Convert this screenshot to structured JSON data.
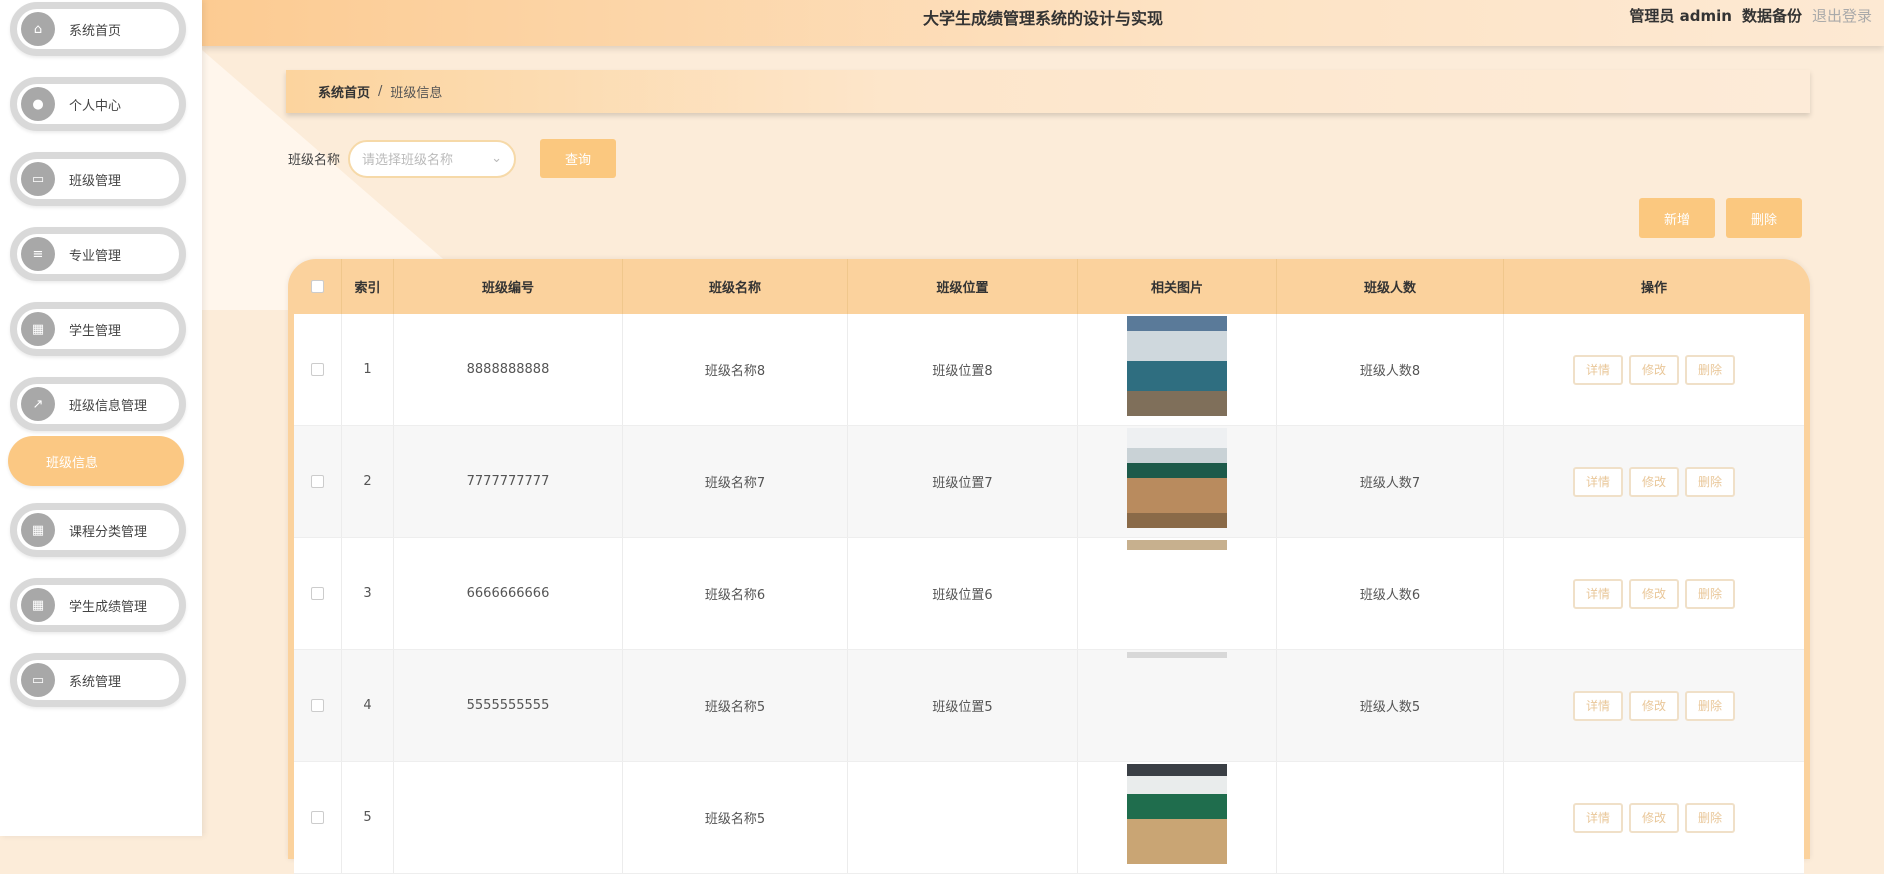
{
  "header": {
    "title": "大学生成绩管理系统的设计与实现",
    "user": "管理员 admin",
    "backup": "数据备份",
    "logout": "退出登录"
  },
  "sidebar": {
    "items": [
      {
        "label": "系统首页",
        "icon": "home-icon"
      },
      {
        "label": "个人中心",
        "icon": "user-icon"
      },
      {
        "label": "班级管理",
        "icon": "message-icon"
      },
      {
        "label": "专业管理",
        "icon": "list-icon"
      },
      {
        "label": "学生管理",
        "icon": "grid-icon"
      },
      {
        "label": "班级信息管理",
        "icon": "chart-icon"
      },
      {
        "label": "班级信息",
        "icon": ""
      },
      {
        "label": "课程分类管理",
        "icon": "grid-icon"
      },
      {
        "label": "学生成绩管理",
        "icon": "grid-icon"
      },
      {
        "label": "系统管理",
        "icon": "monitor-icon"
      }
    ]
  },
  "breadcrumb": {
    "home": "系统首页",
    "sep": "/",
    "current": "班级信息"
  },
  "search": {
    "label": "班级名称",
    "placeholder": "请选择班级名称",
    "query": "查询"
  },
  "actions": {
    "add": "新增",
    "delete": "删除"
  },
  "table": {
    "headers": [
      "索引",
      "班级编号",
      "班级名称",
      "班级位置",
      "相关图片",
      "班级人数",
      "操作"
    ],
    "ops": [
      "详情",
      "修改",
      "删除"
    ],
    "rows": [
      {
        "index": "1",
        "code": "8888888888",
        "name": "班级名称8",
        "location": "班级位置8",
        "count": "班级人数8"
      },
      {
        "index": "2",
        "code": "7777777777",
        "name": "班级名称7",
        "location": "班级位置7",
        "count": "班级人数7"
      },
      {
        "index": "3",
        "code": "6666666666",
        "name": "班级名称6",
        "location": "班级位置6",
        "count": "班级人数6"
      },
      {
        "index": "4",
        "code": "5555555555",
        "name": "班级名称5",
        "location": "班级位置5",
        "count": "班级人数5"
      },
      {
        "index": "5",
        "code": "",
        "name": "班级名称5",
        "location": "",
        "count": ""
      }
    ]
  }
}
